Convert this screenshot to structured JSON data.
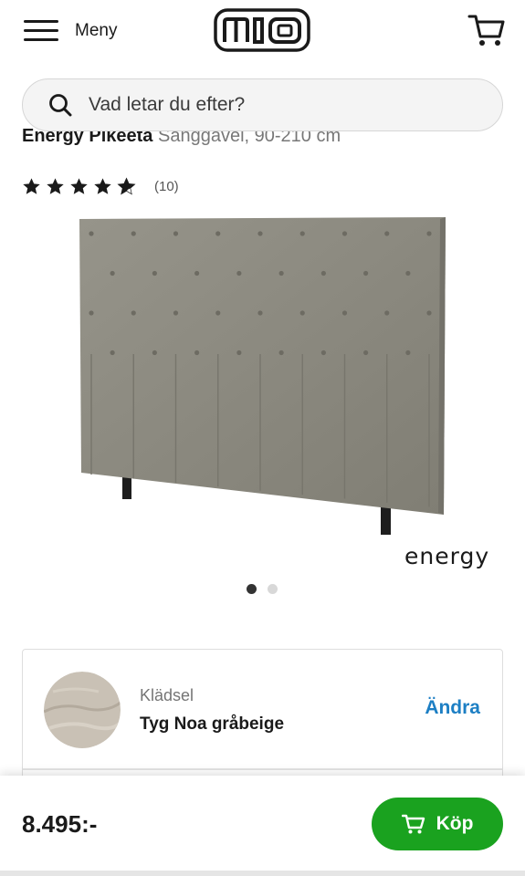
{
  "header": {
    "menu_label": "Meny",
    "logo_text": "mio",
    "cart_icon": "cart-icon",
    "menu_icon": "hamburger-icon"
  },
  "search": {
    "placeholder": "Vad letar du efter?",
    "icon": "search-icon"
  },
  "product": {
    "brand": "Energy Pikeeta",
    "subtitle": "Sänggavel, 90-210 cm",
    "rating": {
      "stars": 4.5,
      "max": 5,
      "count_text": "(10)"
    },
    "image_brand": "energy",
    "carousel": {
      "total": 2,
      "active": 1
    }
  },
  "option": {
    "label": "Klädsel",
    "value": "Tyg Noa gråbeige",
    "change_label": "Ändra"
  },
  "purchase": {
    "price": "8.495:-",
    "buy_label": "Köp"
  },
  "colors": {
    "accent_green": "#1aa21f",
    "link_blue": "#1d7fc4",
    "headboard_grey": "#8c8a7f"
  }
}
